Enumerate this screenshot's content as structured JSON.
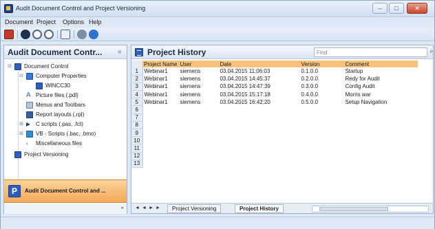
{
  "window": {
    "title": "Audit Document Control and Project Versioning",
    "controls": [
      "–",
      "□",
      "✕"
    ]
  },
  "menu": [
    "Document",
    "Project",
    "Options",
    "Help"
  ],
  "toolbar": {
    "icons": [
      "save-icon",
      "audit-icon",
      "record-icon",
      "stop-icon",
      "grid-icon",
      "settings-icon",
      "info-icon"
    ]
  },
  "left_panel": {
    "title": "Audit Document Contr...",
    "pin": "« ",
    "tree": [
      {
        "label": "Document Control",
        "icon": "folder-icon"
      },
      {
        "label": "Computer Properties",
        "icon": "computer-icon"
      },
      {
        "label": "WINCC30",
        "icon": "station-icon"
      },
      {
        "label": "Picture files (.pdl)",
        "icon": "picture-icon"
      },
      {
        "label": "Menus and Toolbars",
        "icon": "menu-icon"
      },
      {
        "label": "Report layouts (.rpl)",
        "icon": "report-icon"
      },
      {
        "label": "C scripts (.pas, .fct)",
        "icon": "script-icon"
      },
      {
        "label": "VB - Scripts (.bac, .bmo)",
        "icon": "vbscript-icon"
      },
      {
        "label": "Miscellaneous files",
        "icon": "file-icon"
      },
      {
        "label": "Project Versioning",
        "icon": "versioning-icon"
      }
    ],
    "footer_label": "Audit Document Control and ...",
    "footer_icon_letter": "P"
  },
  "right_panel": {
    "title": "Project History",
    "search": {
      "value": "Find",
      "placeholder": "Find"
    },
    "columns": [
      "Project Name",
      "User",
      "Date",
      "Version",
      "Comment"
    ],
    "rows": [
      [
        "Webinar1",
        "siemens",
        "03.04.2015 11:06:03",
        "0.1.0.0",
        "Startup"
      ],
      [
        "Webinar1",
        "siemens",
        "03.04.2015 14:45:37",
        "0.2.0.0",
        "Redy for Audit"
      ],
      [
        "Webinar1",
        "siemens",
        "03.04.2015 14:47:39",
        "0.3.0.0",
        "Config Audit"
      ],
      [
        "Webinar1",
        "siemens",
        "03.04.2015 15:17:18",
        "0.4.0.0",
        "Morris war"
      ],
      [
        "Webinar1",
        "siemens",
        "03.04.2015 16:42:20",
        "0.5.0.0",
        "Setup Navigation"
      ]
    ],
    "row_numbers": [
      "1",
      "2",
      "3",
      "4",
      "5",
      "6",
      "7",
      "8",
      "9",
      "10",
      "11",
      "12",
      "13"
    ],
    "sheet_tabs": [
      "Project Versioning",
      "Project History"
    ],
    "nav_arrows": [
      "◄",
      "◄",
      "►",
      "►"
    ]
  },
  "colors": {
    "header_orange": "#f7c37a",
    "footer_orange": "#f2a85a",
    "chrome_blue": "#dde8f5"
  }
}
